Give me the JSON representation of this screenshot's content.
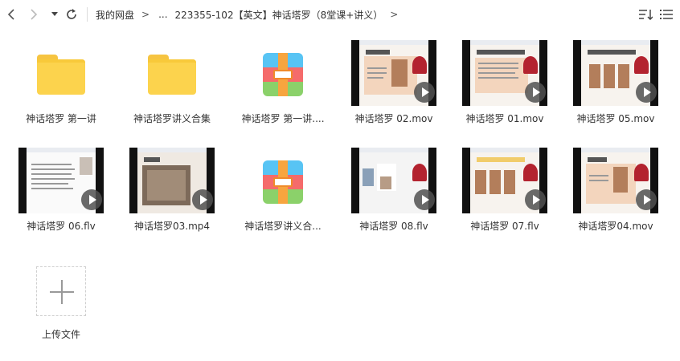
{
  "breadcrumb": {
    "root": "我的网盘",
    "ellipsis": "...",
    "current": "223355-102【英文】神话塔罗（8堂课+讲义）"
  },
  "items": [
    {
      "name": "神话塔罗 第一讲",
      "type": "folder"
    },
    {
      "name": "神话塔罗讲义合集",
      "type": "folder"
    },
    {
      "name": "神话塔罗 第一讲....",
      "type": "archive"
    },
    {
      "name": "神话塔罗 02.mov",
      "type": "video"
    },
    {
      "name": "神话塔罗 01.mov",
      "type": "video"
    },
    {
      "name": "神话塔罗 05.mov",
      "type": "video"
    },
    {
      "name": "神话塔罗 06.flv",
      "type": "video"
    },
    {
      "name": "神话塔罗03.mp4",
      "type": "video"
    },
    {
      "name": "神话塔罗讲义合...",
      "type": "archive"
    },
    {
      "name": "神话塔罗 08.flv",
      "type": "video"
    },
    {
      "name": "神话塔罗 07.flv",
      "type": "video"
    },
    {
      "name": "神话塔罗04.mov",
      "type": "video"
    }
  ],
  "upload": {
    "label": "上传文件"
  },
  "icons": [
    "back-icon",
    "forward-icon",
    "dropdown-icon",
    "refresh-icon",
    "sort-icon",
    "list-view-icon"
  ]
}
